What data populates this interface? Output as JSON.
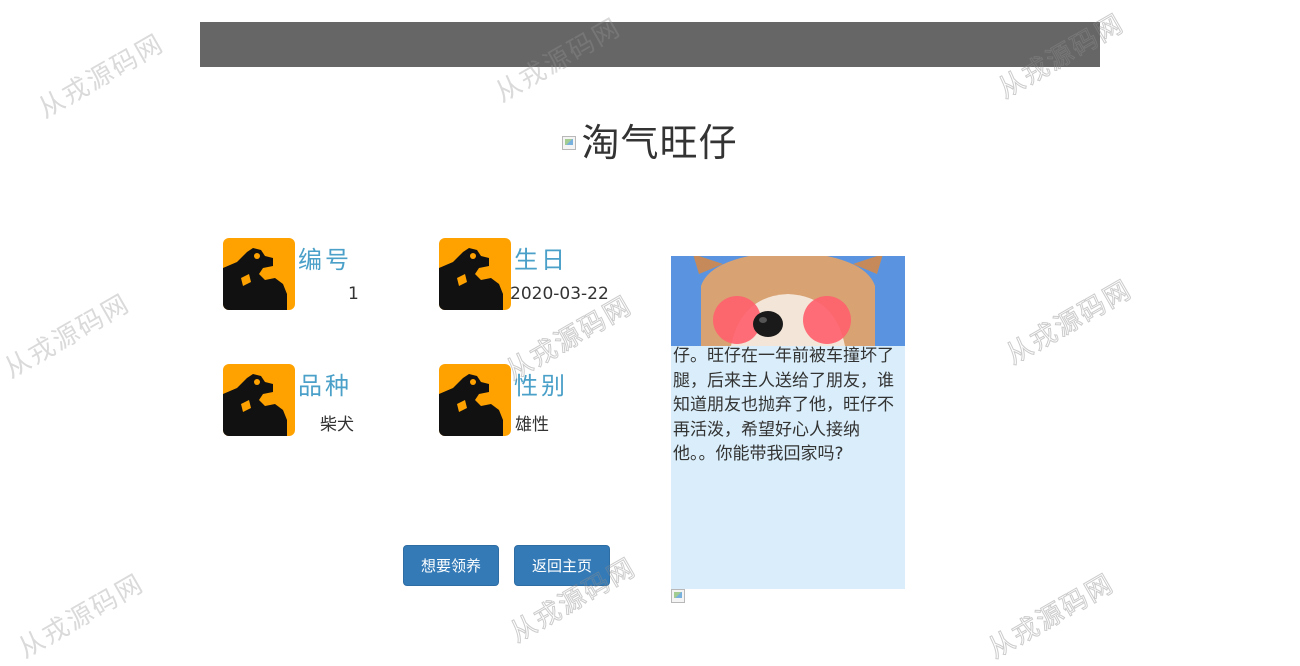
{
  "header": {
    "title": "淘气旺仔"
  },
  "pet_info": {
    "id": {
      "label": "编号",
      "value": "1"
    },
    "birthday": {
      "label": "生日",
      "value": "2020-03-22"
    },
    "breed": {
      "label": "品种",
      "value": "柴犬"
    },
    "gender": {
      "label": "性别",
      "value": "雄性"
    }
  },
  "actions": {
    "adopt": "想要领养",
    "home": "返回主页"
  },
  "profile": {
    "story": "仔。旺仔在一年前被车撞坏了腿，后来主人送给了朋友，谁知道朋友也抛弃了他，旺仔不再活泼，希望好心人接纳他。。你能带我回家吗?"
  },
  "watermark": {
    "text": "从戎源码网"
  },
  "colors": {
    "topbar": "#666666",
    "accent_label": "#4aa0c8",
    "button": "#337ab7",
    "icon_bg": "#ffa200",
    "profile_bg": "#d9eefa"
  },
  "icons": {
    "card": "dog-icon",
    "title": "broken-image-icon"
  }
}
